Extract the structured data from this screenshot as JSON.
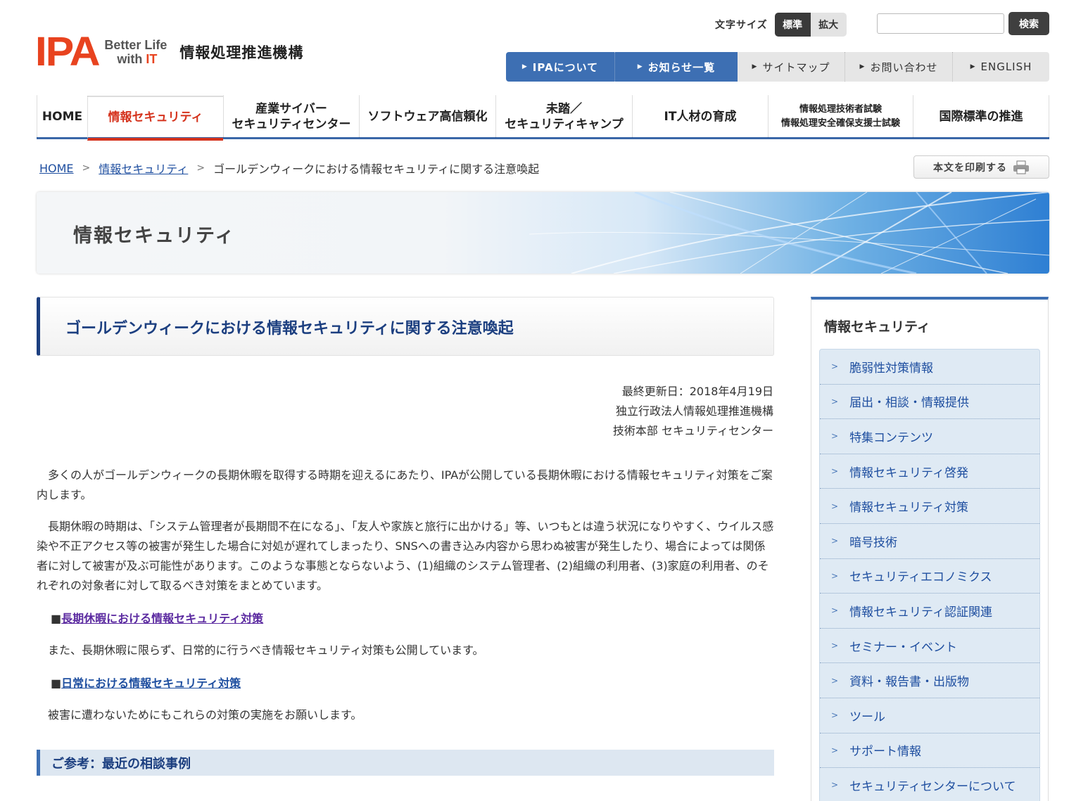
{
  "header": {
    "logo_mark": "IPA",
    "logo_tag_line1": "Better Life",
    "logo_tag_line2_prefix": "with ",
    "logo_tag_line2_it": "IT",
    "org_name": "情報処理推進機構",
    "font_size_label": "文字サイズ",
    "font_size_standard": "標準",
    "font_size_large": "拡大",
    "search_button": "検索",
    "search_value": ""
  },
  "top_nav": [
    {
      "label": "IPAについて"
    },
    {
      "label": "お知らせ一覧"
    },
    {
      "label": "サイトマップ"
    },
    {
      "label": "お問い合わせ"
    },
    {
      "label": "ENGLISH"
    }
  ],
  "global_nav": [
    {
      "label": "HOME"
    },
    {
      "label": "情報セキュリティ"
    },
    {
      "line1": "産業サイバー",
      "line2": "セキュリティセンター"
    },
    {
      "label": "ソフトウェア高信頼化"
    },
    {
      "line1": "未踏／",
      "line2": "セキュリティキャンプ"
    },
    {
      "label": "IT人材の育成"
    },
    {
      "line1": "情報処理技術者試験",
      "line2": "情報処理安全確保支援士試験"
    },
    {
      "label": "国際標準の推進"
    }
  ],
  "breadcrumb": {
    "home": "HOME",
    "section": "情報セキュリティ",
    "current": "ゴールデンウィークにおける情報セキュリティに関する注意喚起"
  },
  "print_button": "本文を印刷する",
  "banner_title": "情報セキュリティ",
  "article": {
    "title": "ゴールデンウィークにおける情報セキュリティに関する注意喚起",
    "updated": "最終更新日：2018年4月19日",
    "org": "独立行政法人情報処理推進機構",
    "dept": "技術本部 セキュリティセンター",
    "p1": "多くの人がゴールデンウィークの長期休暇を取得する時期を迎えるにあたり、IPAが公開している長期休暇における情報セキュリティ対策をご案内します。",
    "p2": "長期休暇の時期は、「システム管理者が長期間不在になる」、「友人や家族と旅行に出かける」等、いつもとは違う状況になりやすく、ウイルス感染や不正アクセス等の被害が発生した場合に対処が遅れてしまったり、SNSへの書き込み内容から思わぬ被害が発生したり、場合によっては関係者に対して被害が及ぶ可能性があります。このような事態とならないよう、(1)組織のシステム管理者、(2)組織の利用者、(3)家庭の利用者、のそれぞれの対象者に対して取るべき対策をまとめています。",
    "bullet": "■",
    "link1": "長期休暇における情報セキュリティ対策",
    "p3": "また、長期休暇に限らず、日常的に行うべき情報セキュリティ対策も公開しています。",
    "link2": "日常における情報セキュリティ対策",
    "p4": "被害に遭わないためにもこれらの対策の実施をお願いします。",
    "ref_heading": "ご参考：最近の相談事例"
  },
  "sidebar": {
    "title": "情報セキュリティ",
    "items": [
      "脆弱性対策情報",
      "届出・相談・情報提供",
      "特集コンテンツ",
      "情報セキュリティ啓発",
      "情報セキュリティ対策",
      "暗号技術",
      "セキュリティエコノミクス",
      "情報セキュリティ認証関連",
      "セミナー・イベント",
      "資料・報告書・出版物",
      "ツール",
      "サポート情報",
      "セキュリティセンターについて"
    ]
  },
  "colors": {
    "brand_red": "#e8431f",
    "nav_blue": "#3d6fb3",
    "heading_navy": "#1c3f80"
  }
}
